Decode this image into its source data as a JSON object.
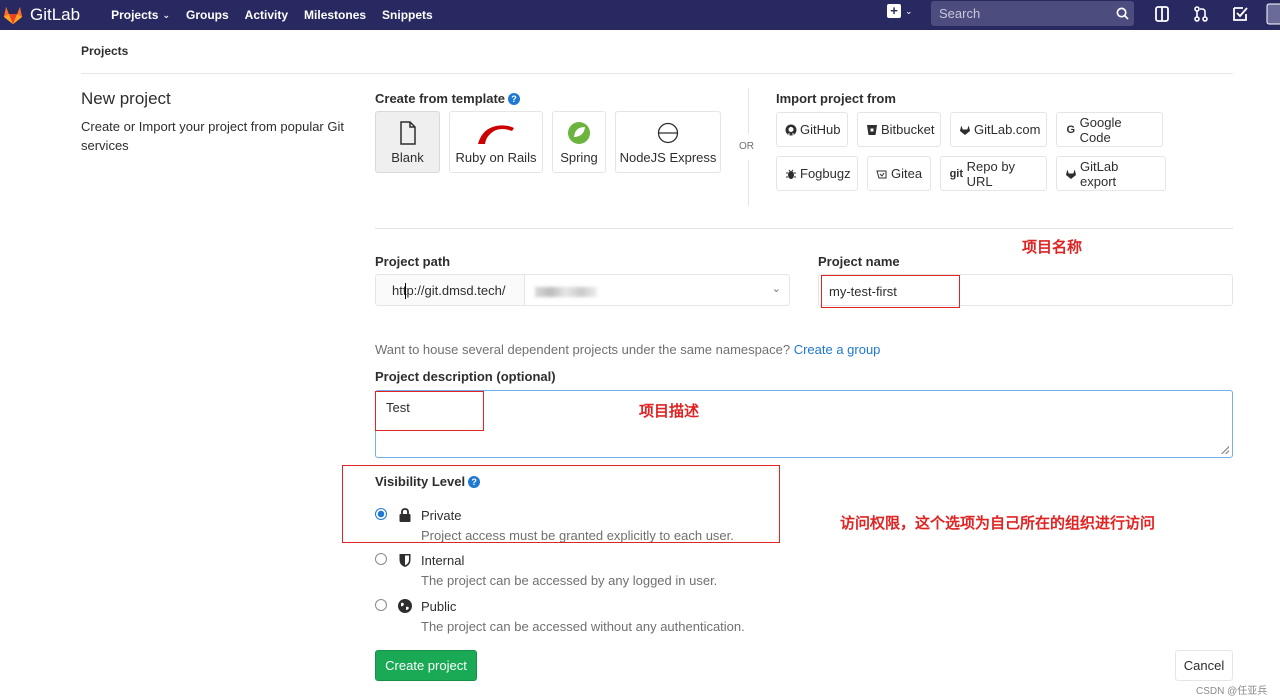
{
  "navbar": {
    "brand": "GitLab",
    "links": [
      "Projects",
      "Groups",
      "Activity",
      "Milestones",
      "Snippets"
    ],
    "search_placeholder": "Search"
  },
  "breadcrumb": "Projects",
  "intro": {
    "title": "New project",
    "description": "Create or Import your project from popular Git services"
  },
  "templates": {
    "label": "Create from template",
    "items": [
      "Blank",
      "Ruby on Rails",
      "Spring",
      "NodeJS Express"
    ],
    "or": "OR"
  },
  "import": {
    "label": "Import project from",
    "row1": [
      "GitHub",
      "Bitbucket",
      "GitLab.com",
      "Google Code"
    ],
    "row2": [
      "Fogbugz",
      "Gitea",
      "Repo by URL",
      "GitLab export"
    ]
  },
  "form": {
    "path_label": "Project path",
    "path_prefix": "http://git.dmsd.tech/",
    "name_label": "Project name",
    "name_value": "my-test-first",
    "hint_text": "Want to house several dependent projects under the same namespace?",
    "hint_link": "Create a group",
    "desc_label": "Project description (optional)",
    "desc_value": "Test",
    "visibility_label": "Visibility Level",
    "visibility": [
      {
        "title": "Private",
        "sub": "Project access must be granted explicitly to each user."
      },
      {
        "title": "Internal",
        "sub": "The project can be accessed by any logged in user."
      },
      {
        "title": "Public",
        "sub": "The project can be accessed without any authentication."
      }
    ],
    "create_button": "Create project",
    "cancel_button": "Cancel"
  },
  "annotations": {
    "name": "项目名称",
    "desc": "项目描述",
    "visibility": "访问权限，这个选项为自己所在的组织进行访问"
  },
  "watermark": "CSDN @任亚兵",
  "colors": {
    "navbar": "#292961",
    "accent": "#1f78d1",
    "success": "#1aaa55",
    "annotation": "#e02424"
  }
}
